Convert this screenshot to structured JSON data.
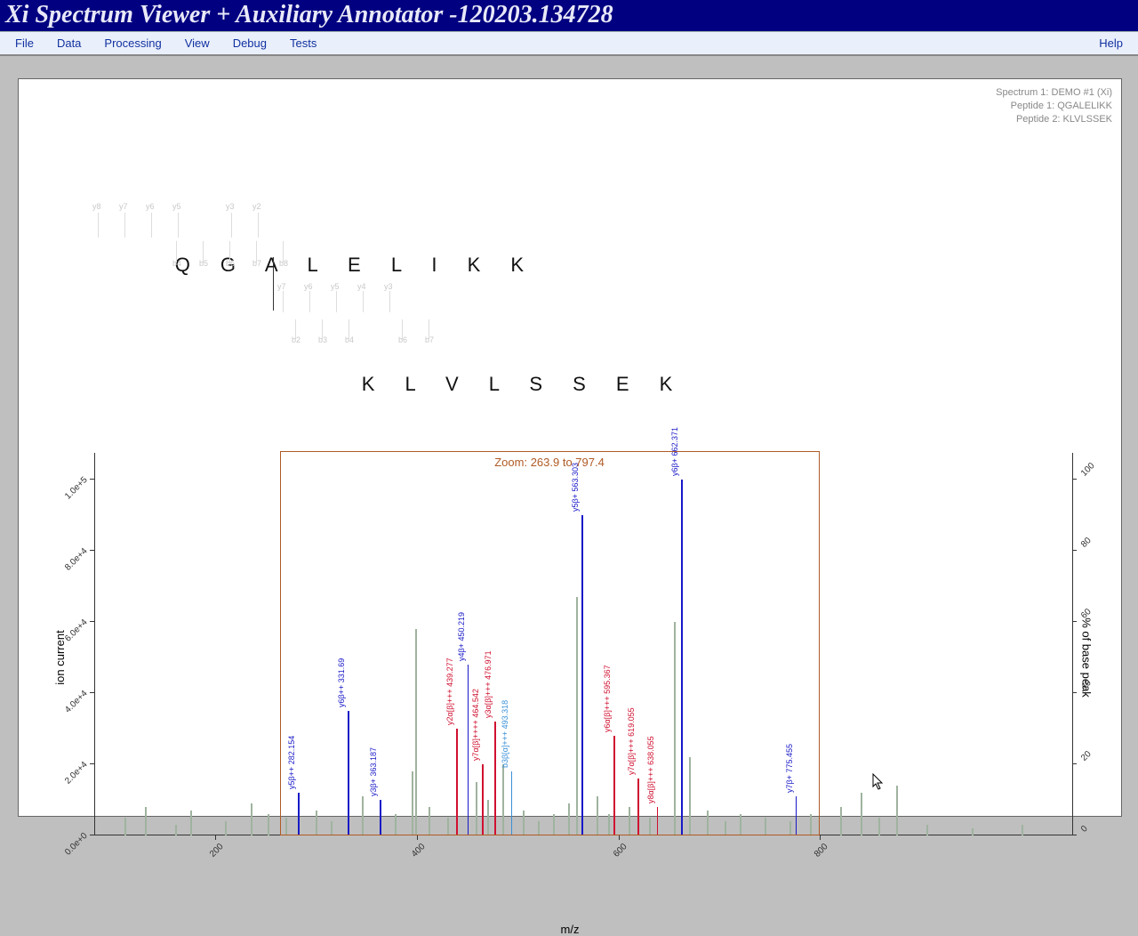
{
  "window_title": "Xi Spectrum Viewer + Auxiliary Annotator -120203.134728",
  "menu": {
    "file": "File",
    "data": "Data",
    "processing": "Processing",
    "view": "View",
    "debug": "Debug",
    "tests": "Tests",
    "help": "Help"
  },
  "info": {
    "spectrum": "Spectrum 1: DEMO #1 (Xi)",
    "peptide1": "Peptide 1: QGALELIKK",
    "peptide2": "Peptide 2: KLVLSSEK"
  },
  "sequences": {
    "top": "Q G A L E L I K K",
    "bottom": "K L V L S S E K",
    "top_y_tags": [
      "y8",
      "y7",
      "y6",
      "y5",
      "y3",
      "y2"
    ],
    "top_b_tags": [
      "b4",
      "b5",
      "b6",
      "b7",
      "b8"
    ],
    "bot_y_tags": [
      "y7",
      "y6",
      "y5",
      "y4",
      "y3"
    ],
    "bot_b_tags": [
      "b2",
      "b3",
      "b4",
      "b6",
      "b7"
    ]
  },
  "zoom_label": "Zoom: 263.9 to 797.4",
  "axes": {
    "xlabel": "m/z",
    "ylabel": "ion current",
    "y2label": "% of base peak",
    "xticks": [
      "200",
      "400",
      "600",
      "800"
    ],
    "yticks": [
      "0.0e+0",
      "2.0e+4",
      "4.0e+4",
      "6.0e+4",
      "8.0e+4",
      "1.0e+5"
    ],
    "y2ticks": [
      "0",
      "20",
      "40",
      "60",
      "80",
      "100"
    ]
  },
  "chart_data": {
    "type": "bar",
    "title": "",
    "xlabel": "m/z",
    "ylabel": "ion current",
    "xlim": [
      80,
      1050
    ],
    "ylim": [
      0,
      105000
    ],
    "y2lim": [
      0,
      100
    ],
    "zoom_range": [
      263.9,
      797.4
    ],
    "annotated_peaks": [
      {
        "label": "y5β++ 282.154",
        "mz": 282.154,
        "rel": 12,
        "color": "#1818c8"
      },
      {
        "label": "y6β++ 331.69",
        "mz": 331.69,
        "rel": 35,
        "color": "#1818c8"
      },
      {
        "label": "y3β+ 363.187",
        "mz": 363.187,
        "rel": 10,
        "color": "#1818c8"
      },
      {
        "label": "y2α[β]+++ 439.277",
        "mz": 439.277,
        "rel": 30,
        "color": "#d01030"
      },
      {
        "label": "y4β+ 450.219",
        "mz": 450.219,
        "rel": 48,
        "color": "#1818c8"
      },
      {
        "label": "y7α[β]++++ 464.542",
        "mz": 464.542,
        "rel": 20,
        "color": "#d01030"
      },
      {
        "label": "y3α[β]+++ 476.971",
        "mz": 476.971,
        "rel": 32,
        "color": "#d01030"
      },
      {
        "label": "b3β[α]+++ 493.318",
        "mz": 493.318,
        "rel": 18,
        "color": "#3a90d8"
      },
      {
        "label": "y5β+ 563.303",
        "mz": 563.303,
        "rel": 90,
        "color": "#1818c8"
      },
      {
        "label": "y6α[β]+++ 595.367",
        "mz": 595.367,
        "rel": 28,
        "color": "#d01030"
      },
      {
        "label": "y7α[β]+++ 619.055",
        "mz": 619.055,
        "rel": 16,
        "color": "#d01030"
      },
      {
        "label": "y8α[β]+++ 638.055",
        "mz": 638.055,
        "rel": 8,
        "color": "#d01030"
      },
      {
        "label": "y6β+ 662.371",
        "mz": 662.371,
        "rel": 100,
        "color": "#1818c8"
      },
      {
        "label": "y7β+ 775.455",
        "mz": 775.455,
        "rel": 11,
        "color": "#1818c8"
      }
    ],
    "unannotated_peaks": [
      {
        "mz": 110,
        "rel": 5
      },
      {
        "mz": 130,
        "rel": 8
      },
      {
        "mz": 160,
        "rel": 3
      },
      {
        "mz": 175,
        "rel": 7
      },
      {
        "mz": 210,
        "rel": 4
      },
      {
        "mz": 235,
        "rel": 9
      },
      {
        "mz": 252,
        "rel": 6
      },
      {
        "mz": 270,
        "rel": 5
      },
      {
        "mz": 300,
        "rel": 7
      },
      {
        "mz": 315,
        "rel": 4
      },
      {
        "mz": 345,
        "rel": 11
      },
      {
        "mz": 378,
        "rel": 6
      },
      {
        "mz": 395,
        "rel": 18
      },
      {
        "mz": 398,
        "rel": 58
      },
      {
        "mz": 412,
        "rel": 8
      },
      {
        "mz": 430,
        "rel": 5
      },
      {
        "mz": 458,
        "rel": 15
      },
      {
        "mz": 470,
        "rel": 10
      },
      {
        "mz": 485,
        "rel": 20
      },
      {
        "mz": 505,
        "rel": 7
      },
      {
        "mz": 520,
        "rel": 4
      },
      {
        "mz": 535,
        "rel": 6
      },
      {
        "mz": 550,
        "rel": 9
      },
      {
        "mz": 558,
        "rel": 67
      },
      {
        "mz": 578,
        "rel": 11
      },
      {
        "mz": 590,
        "rel": 6
      },
      {
        "mz": 610,
        "rel": 8
      },
      {
        "mz": 630,
        "rel": 5
      },
      {
        "mz": 655,
        "rel": 60
      },
      {
        "mz": 670,
        "rel": 22
      },
      {
        "mz": 688,
        "rel": 7
      },
      {
        "mz": 705,
        "rel": 4
      },
      {
        "mz": 720,
        "rel": 6
      },
      {
        "mz": 745,
        "rel": 5
      },
      {
        "mz": 770,
        "rel": 4
      },
      {
        "mz": 790,
        "rel": 6
      },
      {
        "mz": 820,
        "rel": 8
      },
      {
        "mz": 840,
        "rel": 12
      },
      {
        "mz": 858,
        "rel": 5
      },
      {
        "mz": 875,
        "rel": 14
      },
      {
        "mz": 905,
        "rel": 3
      },
      {
        "mz": 950,
        "rel": 2
      },
      {
        "mz": 1000,
        "rel": 3
      }
    ]
  }
}
